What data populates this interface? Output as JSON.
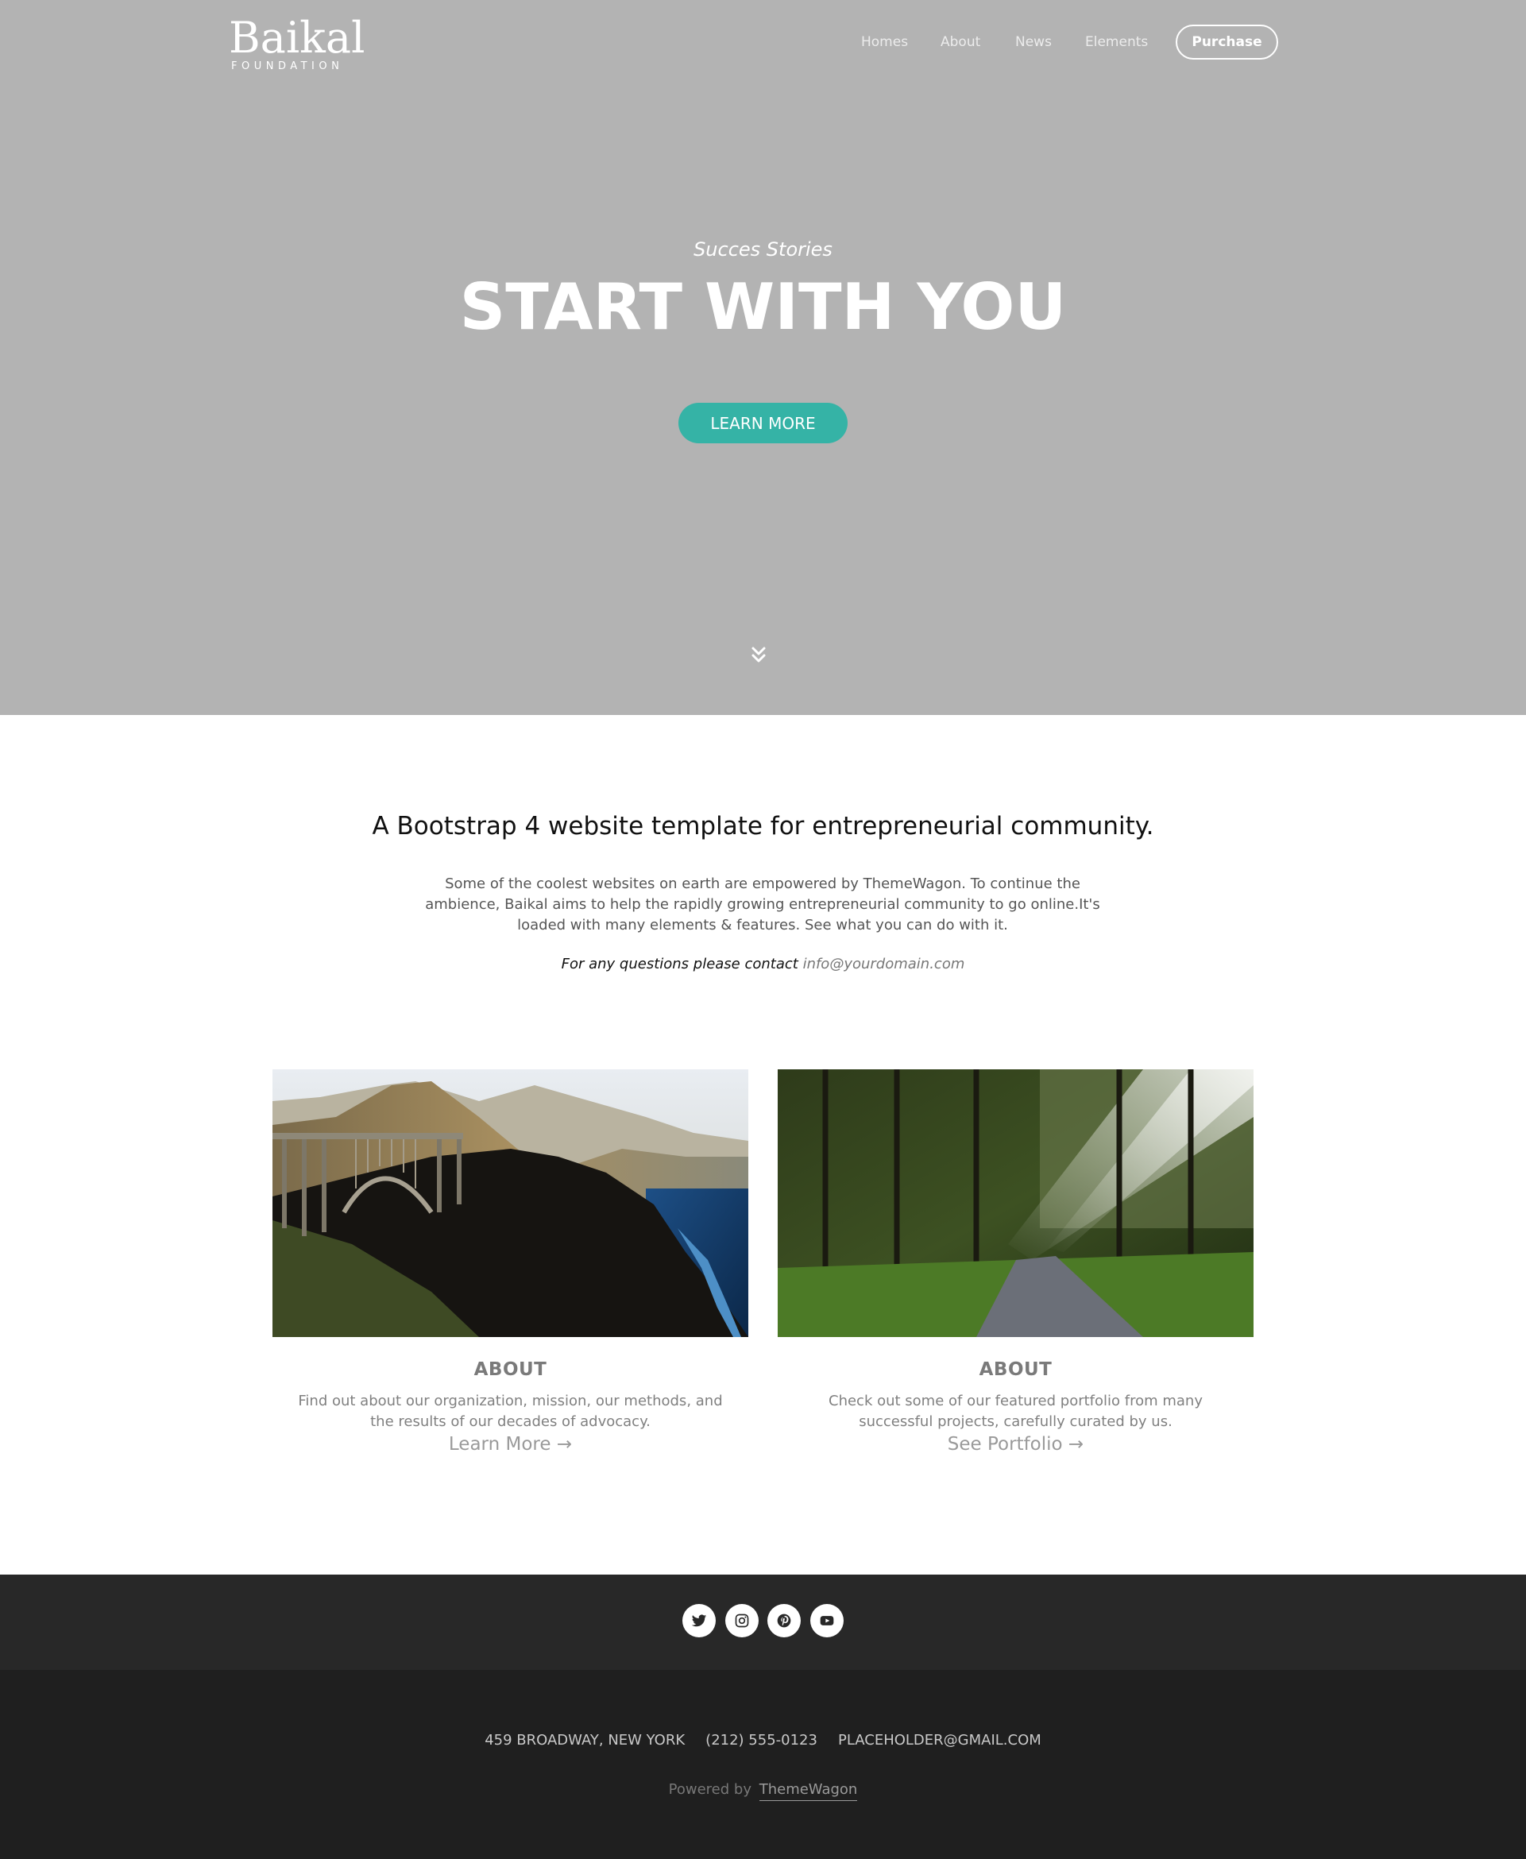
{
  "brand": {
    "name": "Baikal",
    "tagline": "FOUNDATION"
  },
  "nav": {
    "items": [
      "Homes",
      "About",
      "News",
      "Elements"
    ],
    "purchase_label": "Purchase"
  },
  "hero": {
    "subtitle": "Succes Stories",
    "title": "START WITH YOU",
    "button_label": "LEARN MORE",
    "background_color": "#b3b3b3",
    "accent_color": "#35b3a6"
  },
  "intro": {
    "title": "A Bootstrap 4 website template for entrepreneurial community.",
    "paragraph": "Some of the coolest websites on earth are empowered by ThemeWagon. To continue the ambience, Baikal aims to help the rapidly growing entrepreneurial community to go online.It's loaded with many elements & features. See what you can do with it.",
    "contact_prefix": "For any questions please contact ",
    "contact_email": "info@yourdomain.com"
  },
  "cards": [
    {
      "title": "ABOUT",
      "text": "Find out about our organization, mission, our methods, and the results of our decades of advocacy.",
      "link_label": "Learn More →"
    },
    {
      "title": "ABOUT",
      "text": "Check out some of our featured portfolio from many successful projects, carefully curated by us.",
      "link_label": "See Portfolio →"
    }
  ],
  "social": [
    "twitter-icon",
    "instagram-icon",
    "pinterest-icon",
    "youtube-icon"
  ],
  "footer": {
    "address": "459 BROADWAY, NEW YORK",
    "phone": "(212) 555-0123",
    "email": "PLACEHOLDER@GMAIL.COM",
    "powered_by_prefix": "Powered by",
    "powered_by_name": "ThemeWagon"
  }
}
